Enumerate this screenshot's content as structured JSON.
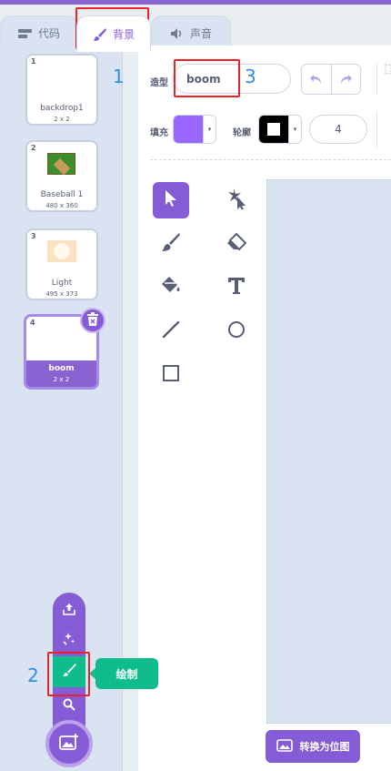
{
  "tabs": [
    {
      "label": "代码",
      "icon": "code-blocks-icon"
    },
    {
      "label": "背景",
      "icon": "paintbrush-icon"
    },
    {
      "label": "声音",
      "icon": "speaker-icon"
    }
  ],
  "backdrops": [
    {
      "number": "1",
      "name": "backdrop1",
      "size": "2 x 2"
    },
    {
      "number": "2",
      "name": "Baseball 1",
      "size": "480 x 360"
    },
    {
      "number": "3",
      "name": "Light",
      "size": "495 x 373"
    },
    {
      "number": "4",
      "name": "boom",
      "size": "2 x 2",
      "selected": true
    }
  ],
  "annotations": {
    "one": "1",
    "two": "2",
    "three": "3"
  },
  "editor": {
    "costume_label": "造型",
    "costume_name": "boom",
    "fill_label": "填充",
    "outline_label": "轮廓",
    "fill_color": "#9966ff",
    "outline_color": "#000000",
    "outline_width": "4",
    "convert_button": "转换为位图"
  },
  "add_menu": {
    "tooltip": "绘制",
    "items": [
      "upload-icon",
      "surprise-icon",
      "paint-icon",
      "search-icon"
    ]
  },
  "colors": {
    "accent": "#855cd6",
    "green": "#0fbd8c",
    "annotation_red": "#e8242a",
    "annotation_blue": "#2d8fea"
  }
}
